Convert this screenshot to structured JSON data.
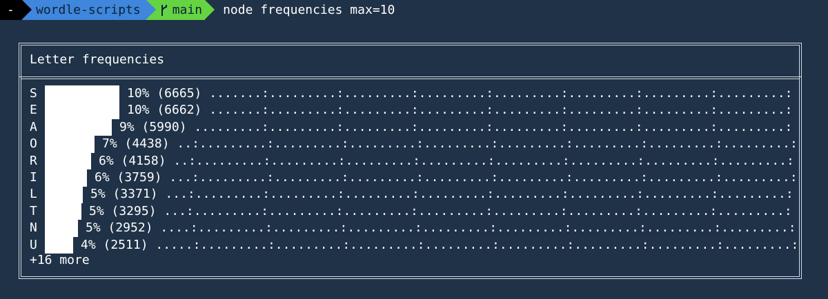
{
  "prompt": {
    "status_symbol": "-",
    "repo": "wordle-scripts",
    "branch": "main",
    "command": "node frequencies max=10"
  },
  "panel": {
    "title": "Letter frequencies",
    "more_label": "+16 more"
  },
  "chart_data": {
    "type": "bar",
    "orientation": "horizontal",
    "title": "Letter frequencies",
    "categories": [
      "S",
      "E",
      "A",
      "O",
      "R",
      "I",
      "L",
      "T",
      "N",
      "U"
    ],
    "values": [
      6665,
      6662,
      5990,
      4438,
      4158,
      3759,
      3371,
      3295,
      2952,
      2511
    ],
    "labels": [
      "10% (6665)",
      "10% (6662)",
      "9% (5990)",
      "7% (4438)",
      "6% (4158)",
      "6% (3759)",
      "5% (3371)",
      "5% (3295)",
      "5% (2952)",
      "4% (2511)"
    ]
  }
}
